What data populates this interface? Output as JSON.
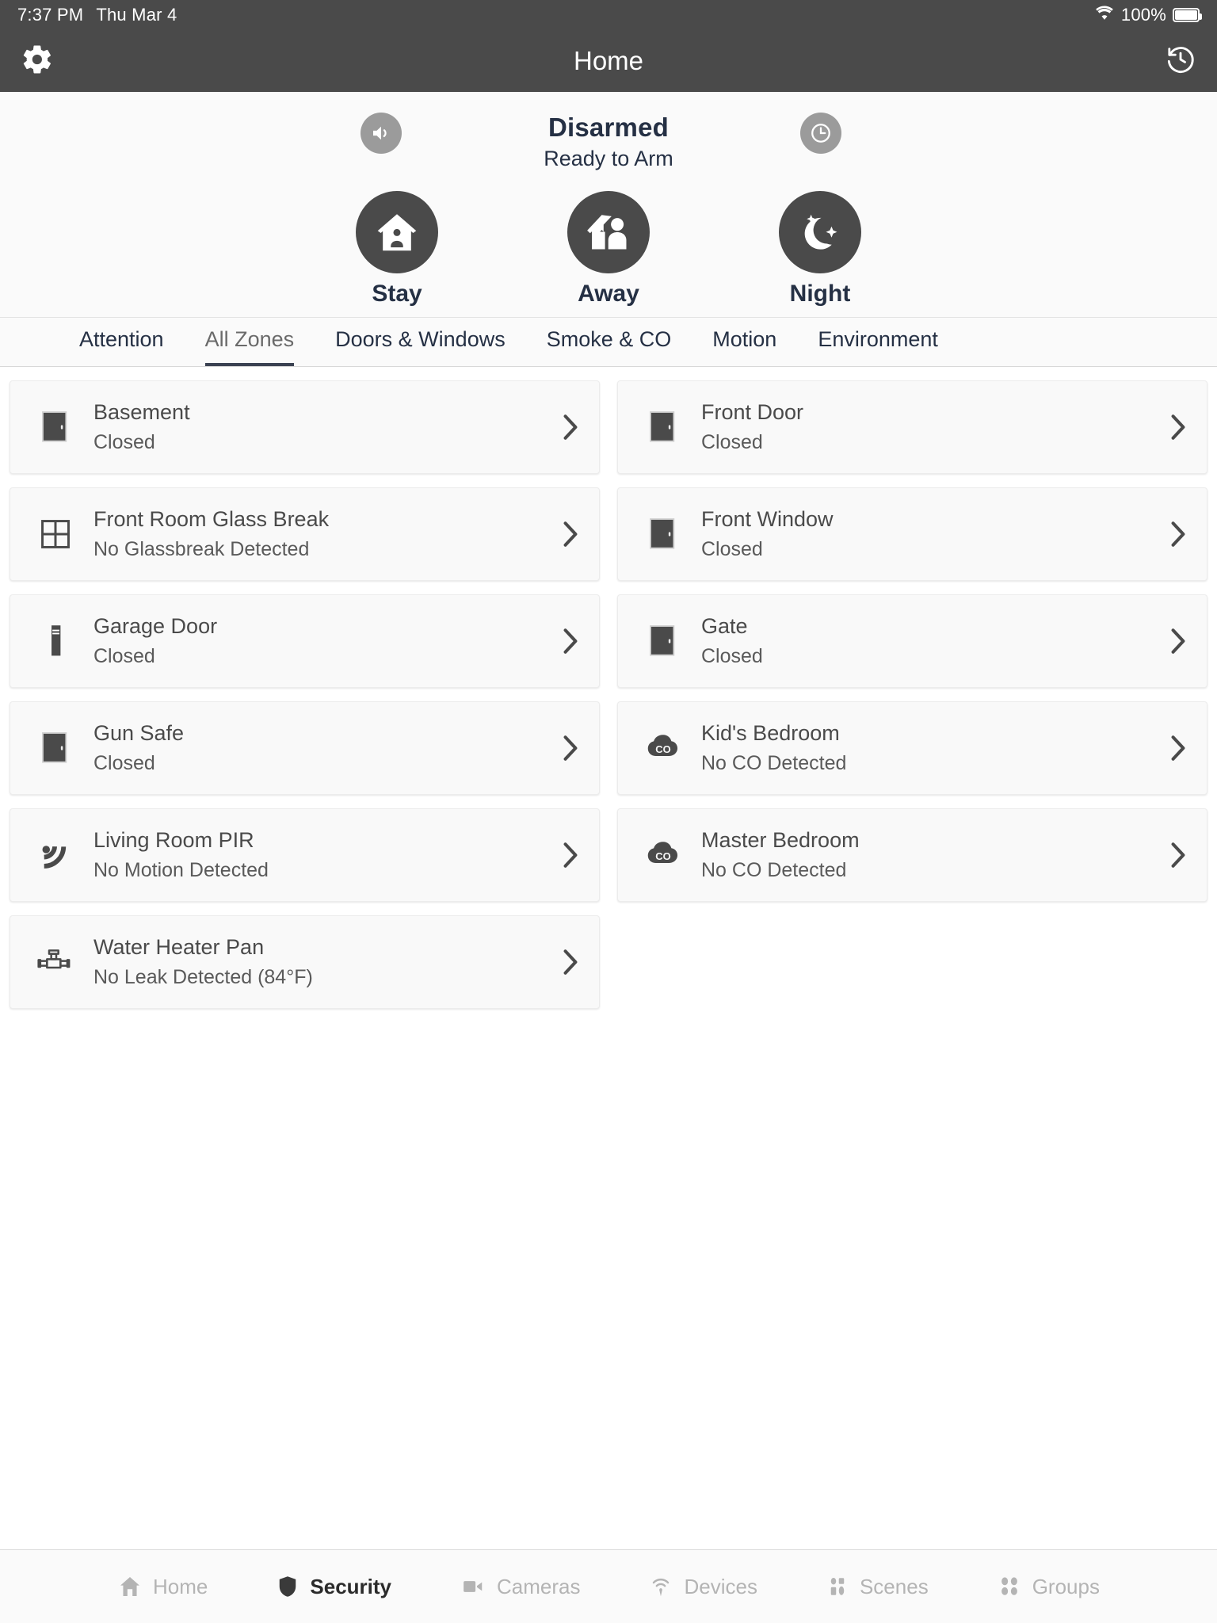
{
  "status_bar": {
    "time": "7:37 PM",
    "date": "Thu Mar 4",
    "battery_percent": "100%",
    "wifi_icon": "wifi-icon",
    "battery_icon": "battery-full-icon"
  },
  "nav_bar": {
    "title": "Home",
    "left_icon": "gear-icon",
    "right_icon": "history-icon"
  },
  "security_panel": {
    "state": "Disarmed",
    "ready_text": "Ready to Arm",
    "left_button_icon": "speaker-icon",
    "right_button_icon": "clock-icon",
    "modes": [
      {
        "label": "Stay",
        "icon": "home-person-icon"
      },
      {
        "label": "Away",
        "icon": "home-leaving-person-icon"
      },
      {
        "label": "Night",
        "icon": "moon-stars-icon"
      }
    ]
  },
  "tabs": {
    "active_index": 1,
    "items": [
      {
        "label": "Attention"
      },
      {
        "label": "All Zones"
      },
      {
        "label": "Doors & Windows"
      },
      {
        "label": "Smoke & CO"
      },
      {
        "label": "Motion"
      },
      {
        "label": "Environment"
      }
    ]
  },
  "zones": [
    {
      "name": "Basement",
      "status": "Closed",
      "icon": "door-icon"
    },
    {
      "name": "Front Door",
      "status": "Closed",
      "icon": "door-icon"
    },
    {
      "name": "Front Room Glass Break",
      "status": "No Glassbreak Detected",
      "icon": "window-icon"
    },
    {
      "name": "Front Window",
      "status": "Closed",
      "icon": "door-icon"
    },
    {
      "name": "Garage Door",
      "status": "Closed",
      "icon": "garage-door-icon"
    },
    {
      "name": "Gate",
      "status": "Closed",
      "icon": "door-icon"
    },
    {
      "name": "Gun Safe",
      "status": "Closed",
      "icon": "door-icon"
    },
    {
      "name": "Kid's Bedroom",
      "status": "No CO Detected",
      "icon": "co-detector-icon"
    },
    {
      "name": "Living Room PIR",
      "status": "No Motion Detected",
      "icon": "motion-icon"
    },
    {
      "name": "Master Bedroom",
      "status": "No CO Detected",
      "icon": "co-detector-icon"
    },
    {
      "name": "Water Heater Pan",
      "status": "No Leak Detected (84°F)",
      "icon": "water-pipe-icon"
    }
  ],
  "chevron_icon": "chevron-right-icon",
  "bottom_nav": {
    "active_index": 1,
    "items": [
      {
        "label": "Home",
        "icon": "house-icon"
      },
      {
        "label": "Security",
        "icon": "shield-icon"
      },
      {
        "label": "Cameras",
        "icon": "video-camera-icon"
      },
      {
        "label": "Devices",
        "icon": "antenna-icon"
      },
      {
        "label": "Scenes",
        "icon": "scenes-icon"
      },
      {
        "label": "Groups",
        "icon": "groups-icon"
      }
    ]
  },
  "colors": {
    "chrome": "#4a4a4a",
    "accent_text": "#253044",
    "panel_bg": "#fafafa",
    "muted": "#b4b4b4"
  }
}
